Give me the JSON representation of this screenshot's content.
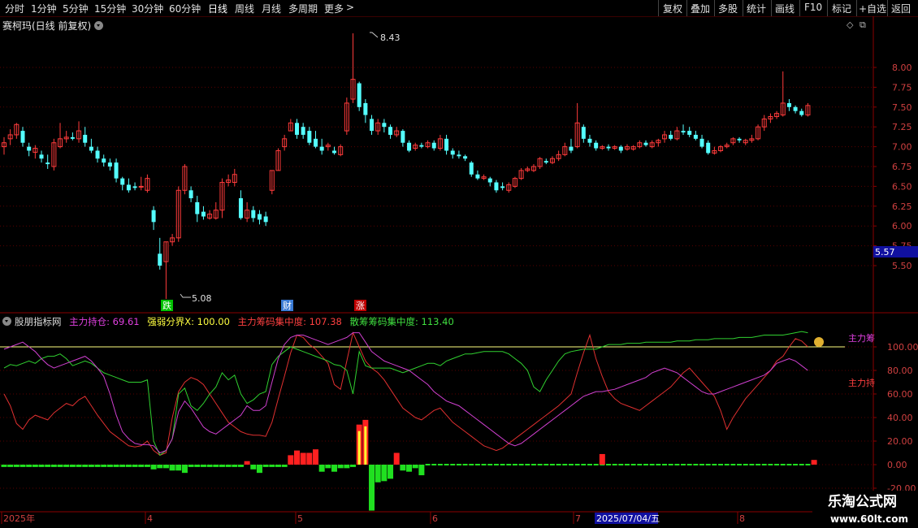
{
  "toolbar": {
    "left": [
      "分时",
      "1分钟",
      "5分钟",
      "15分钟",
      "30分钟",
      "60分钟",
      "日线",
      "周线",
      "月线",
      "多周期",
      "更多"
    ],
    "right": [
      "复权",
      "叠加",
      "多股",
      "统计",
      "画线",
      "F10",
      "标记",
      "+自选",
      "返回"
    ],
    "active": "日线"
  },
  "stock_title": "赛柯玛(日线 前复权)",
  "price_axis": [
    "8.00",
    "7.75",
    "7.50",
    "7.25",
    "7.00",
    "6.75",
    "6.50",
    "6.25",
    "6.00",
    "5.75",
    "5.50"
  ],
  "current_price": "5.57",
  "high_label": "8.43",
  "low_label": "5.08",
  "markers": [
    {
      "text": "跌",
      "color": "#00c000"
    },
    {
      "text": "财",
      "color": "#3a7bd5"
    },
    {
      "text": "涨",
      "color": "#c00000"
    }
  ],
  "indicator": {
    "name": "股朋指标网",
    "items": [
      {
        "label": "主力持仓: 69.61",
        "color": "#e040e0"
      },
      {
        "label": "强弱分界X: 100.00",
        "color": "#ffff40"
      },
      {
        "label": "主力筹码集中度: 107.38",
        "color": "#ff4040"
      },
      {
        "label": "散筹筹码集中度: 113.40",
        "color": "#40e040"
      }
    ],
    "axis": [
      "100.00",
      "80.00",
      "60.00",
      "40.00",
      "20.00",
      "0.00",
      "-20.00"
    ],
    "right_labels": [
      "主力筹",
      "主力持"
    ]
  },
  "date_axis": [
    "2025年",
    "4",
    "5",
    "6",
    "7",
    "2025/07/04/五",
    "8"
  ],
  "watermark": {
    "line1": "乐淘公式网",
    "line2": "www.60lt.com"
  },
  "colors": {
    "up": "#ff3b3b",
    "down": "#54ffff",
    "grid": "#5a0000",
    "bg": "#000000"
  }
}
